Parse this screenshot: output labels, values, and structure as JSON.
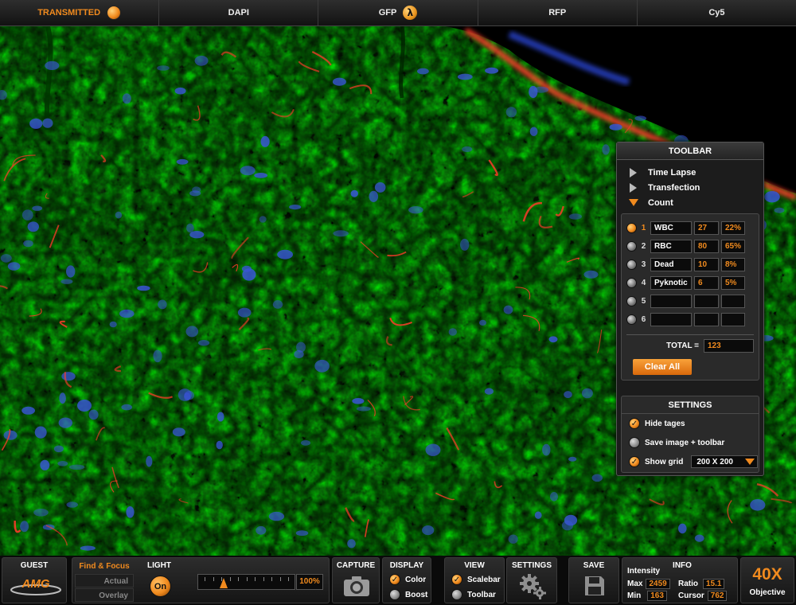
{
  "channels": [
    {
      "label": "TRANSMITTED",
      "active": true,
      "indicator": "orange-dot-icon"
    },
    {
      "label": "DAPI",
      "active": false,
      "indicator": ""
    },
    {
      "label": "GFP",
      "active": false,
      "indicator": "lambda-icon"
    },
    {
      "label": "RFP",
      "active": false,
      "indicator": ""
    },
    {
      "label": "Cy5",
      "active": false,
      "indicator": ""
    }
  ],
  "toolbar": {
    "title": "TOOLBAR",
    "modes": [
      {
        "label": "Time Lapse",
        "expanded": false
      },
      {
        "label": "Transfection",
        "expanded": false
      },
      {
        "label": "Count",
        "expanded": true
      }
    ],
    "count_rows": [
      {
        "num": "1",
        "name": "WBC",
        "value": "27",
        "pct": "22%",
        "selected": true
      },
      {
        "num": "2",
        "name": "RBC",
        "value": "80",
        "pct": "65%",
        "selected": false
      },
      {
        "num": "3",
        "name": "Dead",
        "value": "10",
        "pct": "8%",
        "selected": false
      },
      {
        "num": "4",
        "name": "Pyknotic",
        "value": "6",
        "pct": "5%",
        "selected": false
      },
      {
        "num": "5",
        "name": "",
        "value": "",
        "pct": "",
        "selected": false
      },
      {
        "num": "6",
        "name": "",
        "value": "",
        "pct": "",
        "selected": false
      }
    ],
    "total_label": "TOTAL =",
    "total_value": "123",
    "clear_label": "Clear All"
  },
  "settings": {
    "title": "SETTINGS",
    "hide_tags_label": "Hide tages",
    "hide_tags_checked": true,
    "save_image_label": "Save image + toolbar",
    "save_image_checked": false,
    "show_grid_label": "Show grid",
    "show_grid_checked": true,
    "grid_size": "200 X 200"
  },
  "bottom": {
    "guest_label": "GUEST",
    "logo_text": "AMG",
    "find_focus_label": "Find & Focus",
    "actual_label": "Actual",
    "overlay_label": "Overlay",
    "light_label": "LIGHT",
    "light_on_label": "On",
    "light_percent": "100%",
    "light_level": 0.2,
    "capture_label": "CAPTURE",
    "display_label": "DISPLAY",
    "color_label": "Color",
    "color_checked": true,
    "boost_label": "Boost",
    "boost_checked": false,
    "view_label": "VIEW",
    "scalebar_label": "Scalebar",
    "scalebar_checked": true,
    "toolbar_label": "Toolbar",
    "toolbar_checked": false,
    "settings_label": "SETTINGS",
    "save_label": "SAVE",
    "info_label": "INFO",
    "intensity_label": "Intensity",
    "max_label": "Max",
    "max_value": "2459",
    "min_label": "Min",
    "min_value": "163",
    "ratio_label": "Ratio",
    "ratio_value": "15.1",
    "cursor_label": "Cursor",
    "cursor_value": "762",
    "objective_value": "40X",
    "objective_label": "Objective"
  },
  "colors": {
    "accent": "#f08a1e",
    "tissue_green": "#3fd62a",
    "nuclei_blue": "#3a55d8",
    "fiber_red": "#ff3a2a"
  }
}
